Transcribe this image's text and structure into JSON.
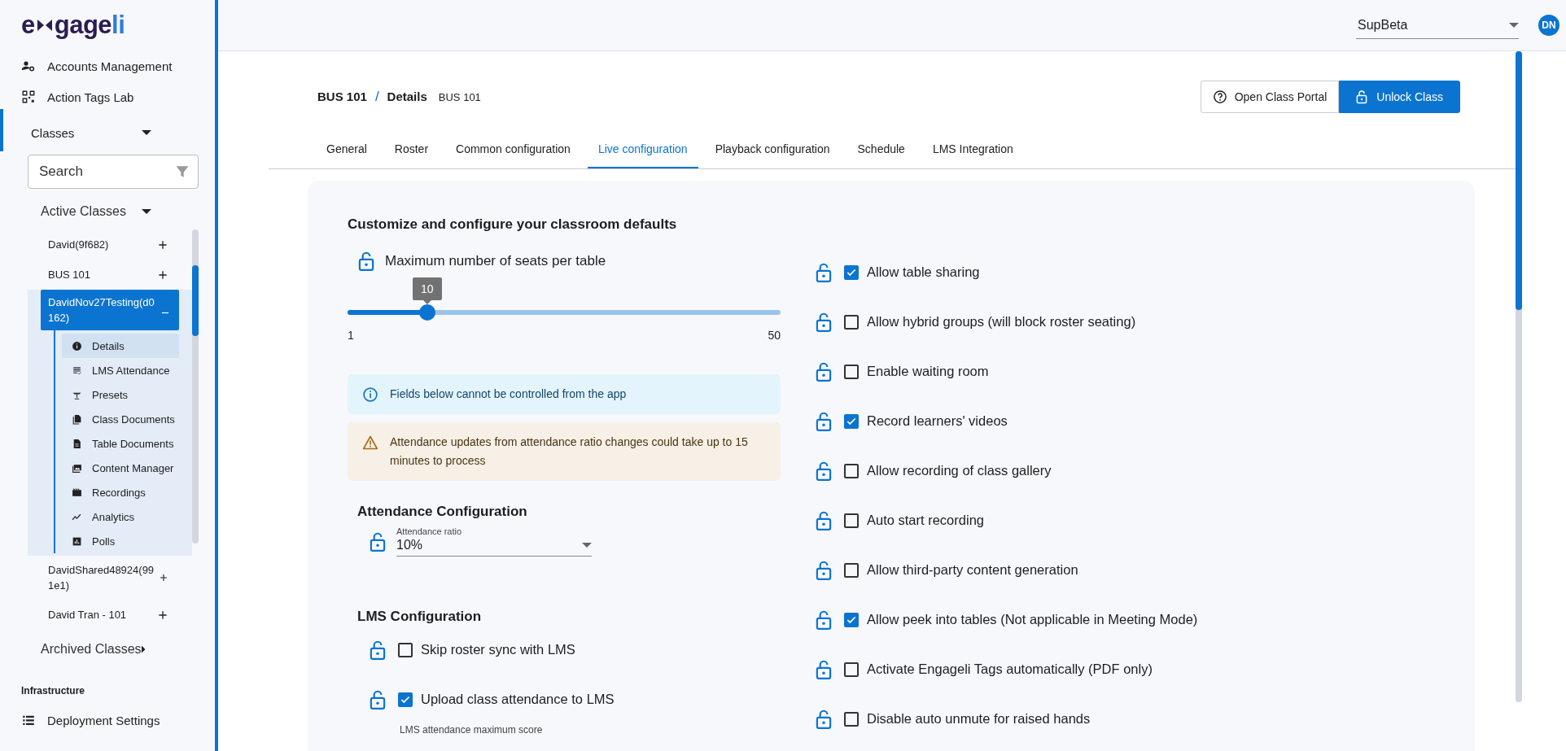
{
  "logo": {
    "start": "e",
    "middle": "gage",
    "end": "li"
  },
  "sidebar": {
    "nav": [
      {
        "label": "Accounts Management"
      },
      {
        "label": "Action Tags Lab"
      }
    ],
    "classes": {
      "label": "Classes",
      "expanded": true
    },
    "search": {
      "placeholder": "Search"
    },
    "active_classes": {
      "label": "Active Classes",
      "expanded": true,
      "items": [
        {
          "label": "David(9f682)",
          "expanded": false
        },
        {
          "label": "BUS 101",
          "expanded": false
        },
        {
          "label": "DavidNov27Testing(d0162)",
          "expanded": true,
          "children": [
            {
              "label": "Details",
              "selected": true
            },
            {
              "label": "LMS Attendance",
              "selected": false
            },
            {
              "label": "Presets",
              "selected": false
            },
            {
              "label": "Class Documents",
              "selected": false
            },
            {
              "label": "Table Documents",
              "selected": false
            },
            {
              "label": "Content Manager",
              "selected": false
            },
            {
              "label": "Recordings",
              "selected": false
            },
            {
              "label": "Analytics",
              "selected": false
            },
            {
              "label": "Polls",
              "selected": false
            }
          ]
        },
        {
          "label": "DavidShared48924(991e1)",
          "expanded": false
        },
        {
          "label": "David Tran - 101",
          "expanded": false
        }
      ]
    },
    "archived_classes": {
      "label": "Archived Classes",
      "expanded": false
    },
    "section_heading": "Infrastructure",
    "bottom_nav": [
      {
        "label": "Deployment Settings"
      }
    ]
  },
  "topbar": {
    "org_select": {
      "value": "SupBeta"
    },
    "avatar": "DN"
  },
  "breadcrumb": {
    "parts": [
      "BUS 101",
      "Details"
    ],
    "separator": "/",
    "subtitle": "BUS 101"
  },
  "buttons": [
    {
      "label": "Open Class Portal",
      "kind": "outline"
    },
    {
      "label": "Unlock Class",
      "kind": "primary"
    }
  ],
  "tabs": [
    {
      "label": "General",
      "selected": false
    },
    {
      "label": "Roster",
      "selected": false
    },
    {
      "label": "Common configuration",
      "selected": false
    },
    {
      "label": "Live configuration",
      "selected": true
    },
    {
      "label": "Playback configuration",
      "selected": false
    },
    {
      "label": "Schedule",
      "selected": false
    },
    {
      "label": "LMS Integration",
      "selected": false
    }
  ],
  "panel": {
    "heading": "Customize and configure your classroom defaults",
    "slider": {
      "label": "Maximum number of seats per table",
      "locked": false,
      "value_label": "10",
      "min_label": "1",
      "max_label": "50",
      "level": 0.184
    },
    "alerts": [
      {
        "kind": "info",
        "text": "Fields below cannot be controlled from the app"
      },
      {
        "kind": "warning",
        "text": "Attendance updates from attendance ratio changes could take up to 15 minutes to process"
      }
    ],
    "attendance": {
      "heading": "Attendance Configuration",
      "select": {
        "label": "Attendance ratio",
        "value": "10%",
        "locked": false
      }
    },
    "lms": {
      "heading": "LMS Configuration",
      "options": [
        {
          "label": "Skip roster sync with LMS",
          "checked": false,
          "locked": false
        },
        {
          "label": "Upload class attendance to LMS",
          "checked": true,
          "locked": false
        }
      ],
      "field_label": "LMS attendance maximum score"
    },
    "options": [
      {
        "label": "Allow table sharing",
        "checked": true,
        "locked": false
      },
      {
        "label": "Allow hybrid groups (will block roster seating)",
        "checked": false,
        "locked": false
      },
      {
        "label": "Enable waiting room",
        "checked": false,
        "locked": false
      },
      {
        "label": "Record learners' videos",
        "checked": true,
        "locked": false
      },
      {
        "label": "Allow recording of class gallery",
        "checked": false,
        "locked": false
      },
      {
        "label": "Auto start recording",
        "checked": false,
        "locked": false
      },
      {
        "label": "Allow third-party content generation",
        "checked": false,
        "locked": false
      },
      {
        "label": "Allow peek into tables (Not applicable in Meeting Mode)",
        "checked": true,
        "locked": false
      },
      {
        "label": "Activate Engageli Tags automatically (PDF only)",
        "checked": false,
        "locked": false
      },
      {
        "label": "Disable auto unmute for raised hands",
        "checked": false,
        "locked": false
      }
    ]
  }
}
